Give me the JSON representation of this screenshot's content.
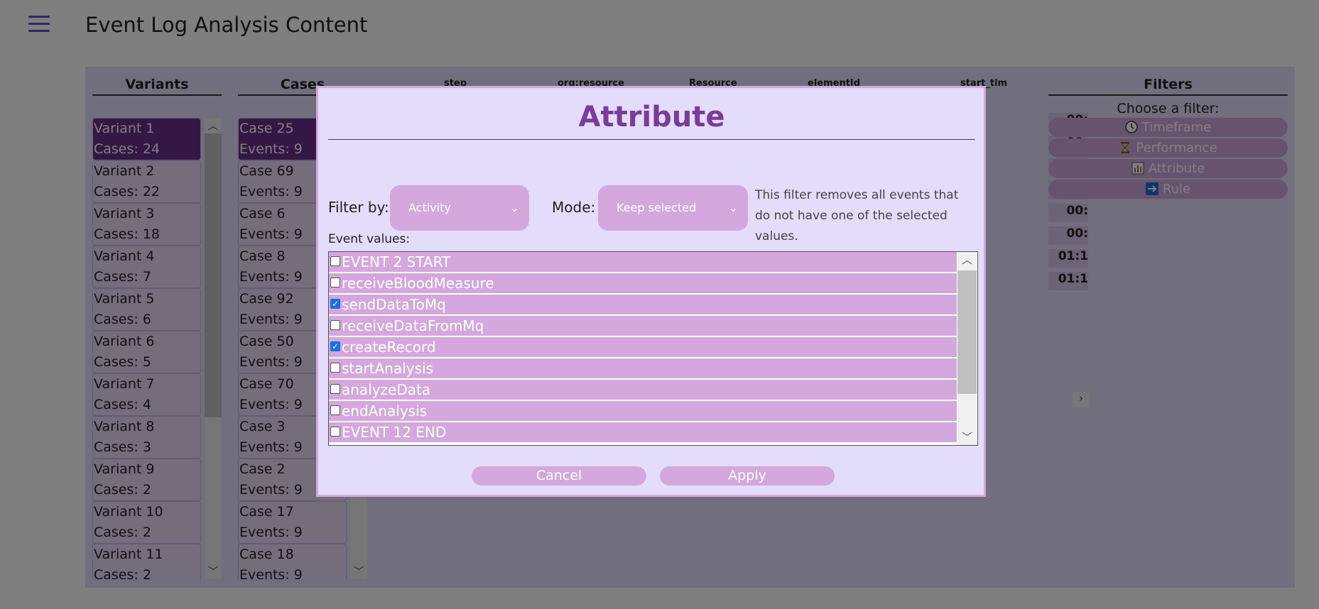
{
  "page_title": "Event Log Analysis Content",
  "variants": {
    "header": "Variants",
    "items": [
      {
        "name": "Variant 1",
        "count": "Cases: 24"
      },
      {
        "name": "Variant 2",
        "count": "Cases: 22"
      },
      {
        "name": "Variant 3",
        "count": "Cases: 18"
      },
      {
        "name": "Variant 4",
        "count": "Cases: 7"
      },
      {
        "name": "Variant 5",
        "count": "Cases: 6"
      },
      {
        "name": "Variant 6",
        "count": "Cases: 5"
      },
      {
        "name": "Variant 7",
        "count": "Cases: 4"
      },
      {
        "name": "Variant 8",
        "count": "Cases: 3"
      },
      {
        "name": "Variant 9",
        "count": "Cases: 2"
      },
      {
        "name": "Variant 10",
        "count": "Cases: 2"
      },
      {
        "name": "Variant 11",
        "count": "Cases: 2"
      }
    ]
  },
  "cases": {
    "header": "Cases",
    "items": [
      {
        "name": "Case 25",
        "count": "Events: 9"
      },
      {
        "name": "Case 69",
        "count": "Events: 9"
      },
      {
        "name": "Case 6",
        "count": "Events: 9"
      },
      {
        "name": "Case 8",
        "count": "Events: 9"
      },
      {
        "name": "Case 92",
        "count": "Events: 9"
      },
      {
        "name": "Case 50",
        "count": "Events: 9"
      },
      {
        "name": "Case 70",
        "count": "Events: 9"
      },
      {
        "name": "Case 3",
        "count": "Events: 9"
      },
      {
        "name": "Case 2",
        "count": "Events: 9"
      },
      {
        "name": "Case 17",
        "count": "Events: 9"
      },
      {
        "name": "Case 18",
        "count": "Events: 9"
      }
    ]
  },
  "event_table": {
    "headers": [
      "step",
      "org:resource",
      "Resource",
      "elementId",
      "start_tim"
    ],
    "time_cells": [
      "00:",
      "00:",
      "00:",
      "00:",
      "00:",
      "00:",
      "01:1",
      "01:1"
    ]
  },
  "filters": {
    "title": "Filters",
    "choose_label": "Choose a filter:",
    "buttons": [
      {
        "label": "Timeframe",
        "icon": "clock-icon"
      },
      {
        "label": "Performance",
        "icon": "hourglass-icon"
      },
      {
        "label": "Attribute",
        "icon": "bar-chart-icon"
      },
      {
        "label": "Rule",
        "icon": "arrow-right-icon"
      }
    ]
  },
  "modal": {
    "title": "Attribute",
    "filter_by_label": "Filter by:",
    "filter_by_value": "Activity",
    "mode_label": "Mode:",
    "mode_value": "Keep selected",
    "description": "This filter removes all events that do not have one of the selected values.",
    "event_values_label": "Event values:",
    "event_values": [
      {
        "label": "EVENT 2 START",
        "checked": false
      },
      {
        "label": "receiveBloodMeasure",
        "checked": false
      },
      {
        "label": "sendDataToMq",
        "checked": true
      },
      {
        "label": "receiveDataFromMq",
        "checked": false
      },
      {
        "label": "createRecord",
        "checked": true
      },
      {
        "label": "startAnalysis",
        "checked": false
      },
      {
        "label": "analyzeData",
        "checked": false
      },
      {
        "label": "endAnalysis",
        "checked": false
      },
      {
        "label": "EVENT 12 END",
        "checked": false
      }
    ],
    "cancel_label": "Cancel",
    "apply_label": "Apply"
  }
}
